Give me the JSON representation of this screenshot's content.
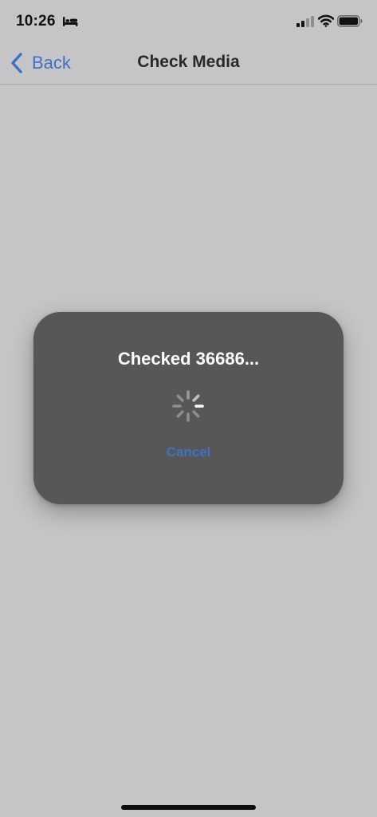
{
  "status_bar": {
    "time": "10:26",
    "focus_icon": "bed-icon",
    "signal_icon": "cellular-signal-icon",
    "wifi_icon": "wifi-icon",
    "battery_icon": "battery-icon"
  },
  "nav": {
    "back_label": "Back",
    "back_icon": "chevron-left-icon",
    "title": "Check Media"
  },
  "dialog": {
    "title": "Checked 36686...",
    "spinner_icon": "activity-spinner-icon",
    "cancel_label": "Cancel"
  },
  "colors": {
    "background": "#c5c5c7",
    "dialog_background": "#575757",
    "accent": "#3d72c2",
    "nav_title": "#2a2a2a",
    "dialog_text": "#ffffff"
  }
}
